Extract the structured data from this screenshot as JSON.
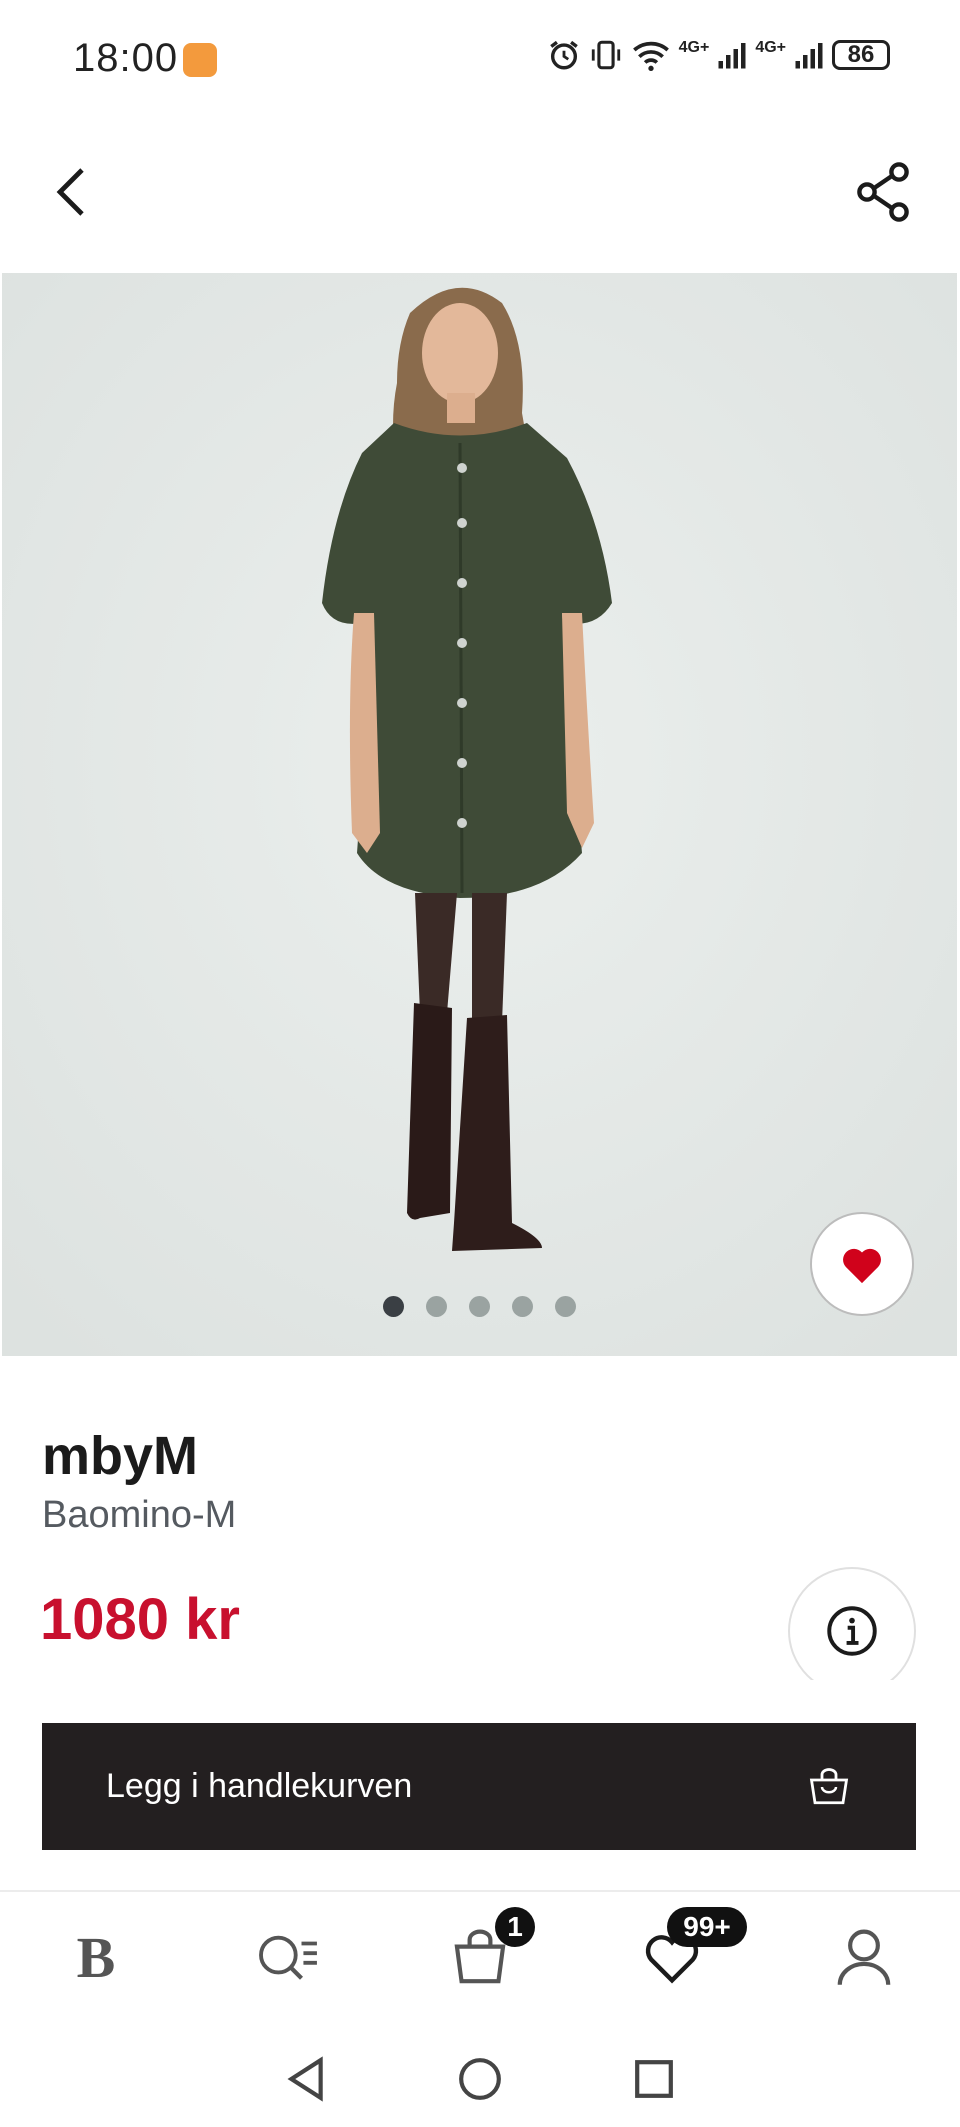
{
  "status_bar": {
    "time": "18:00",
    "network_1": "4G+",
    "network_2": "4G+",
    "battery": "86"
  },
  "app_bar": {
    "back_icon": "chevron-left-icon",
    "share_icon": "share-icon"
  },
  "product": {
    "brand": "mbyM",
    "name": "Baomino-M",
    "price": "1080 kr",
    "image_count": 5,
    "active_image": 1,
    "favorited": true
  },
  "actions": {
    "add_to_cart_label": "Legg i handlekurven"
  },
  "tab_bar": {
    "items": [
      {
        "icon": "brand-logo-icon",
        "label": "B"
      },
      {
        "icon": "search-menu-icon"
      },
      {
        "icon": "shopping-bag-icon",
        "badge": "1"
      },
      {
        "icon": "heart-icon",
        "badge": "99+"
      },
      {
        "icon": "profile-icon"
      }
    ]
  },
  "colors": {
    "price": "#c8102e",
    "button_bg": "#231f20",
    "heart": "#d0021b",
    "status_app": "#f39a3d"
  }
}
